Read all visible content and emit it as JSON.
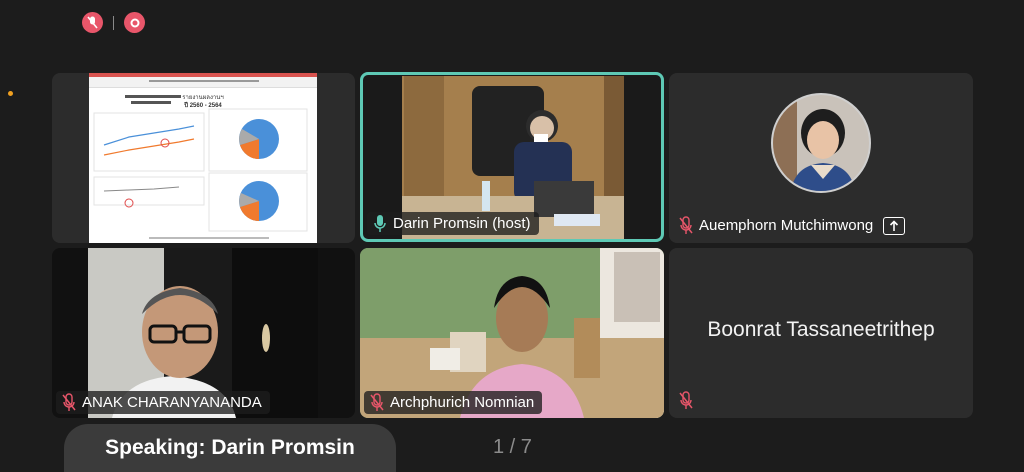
{
  "participants": [
    {
      "name": "Darin Promsin (host)",
      "mic": "on",
      "active": true
    },
    {
      "name": "Auemphorn Mutchimwong",
      "mic": "muted",
      "has_share_icon": true
    },
    {
      "name": "ANAK CHARANYANANDA",
      "mic": "muted"
    },
    {
      "name": "Archphurich Nomnian",
      "mic": "muted"
    },
    {
      "name": "Boonrat Tassaneetrithep",
      "mic": "muted",
      "video": "off"
    }
  ],
  "speaking": {
    "label": "Speaking: Darin Promsin"
  },
  "pagination": {
    "label": "1 / 7"
  },
  "shared_slide": {
    "title": "รายงานผลงานฯ",
    "years": "ปี 2560 - 2564"
  },
  "colors": {
    "accent": "#5ec9b5",
    "muted_red": "#e8566a",
    "tile_bg": "#2c2c2c",
    "page_bg": "#1c1c1c"
  },
  "icons": [
    "mic-muted-icon",
    "stop-record-icon",
    "mic-on-icon",
    "share-icon"
  ]
}
